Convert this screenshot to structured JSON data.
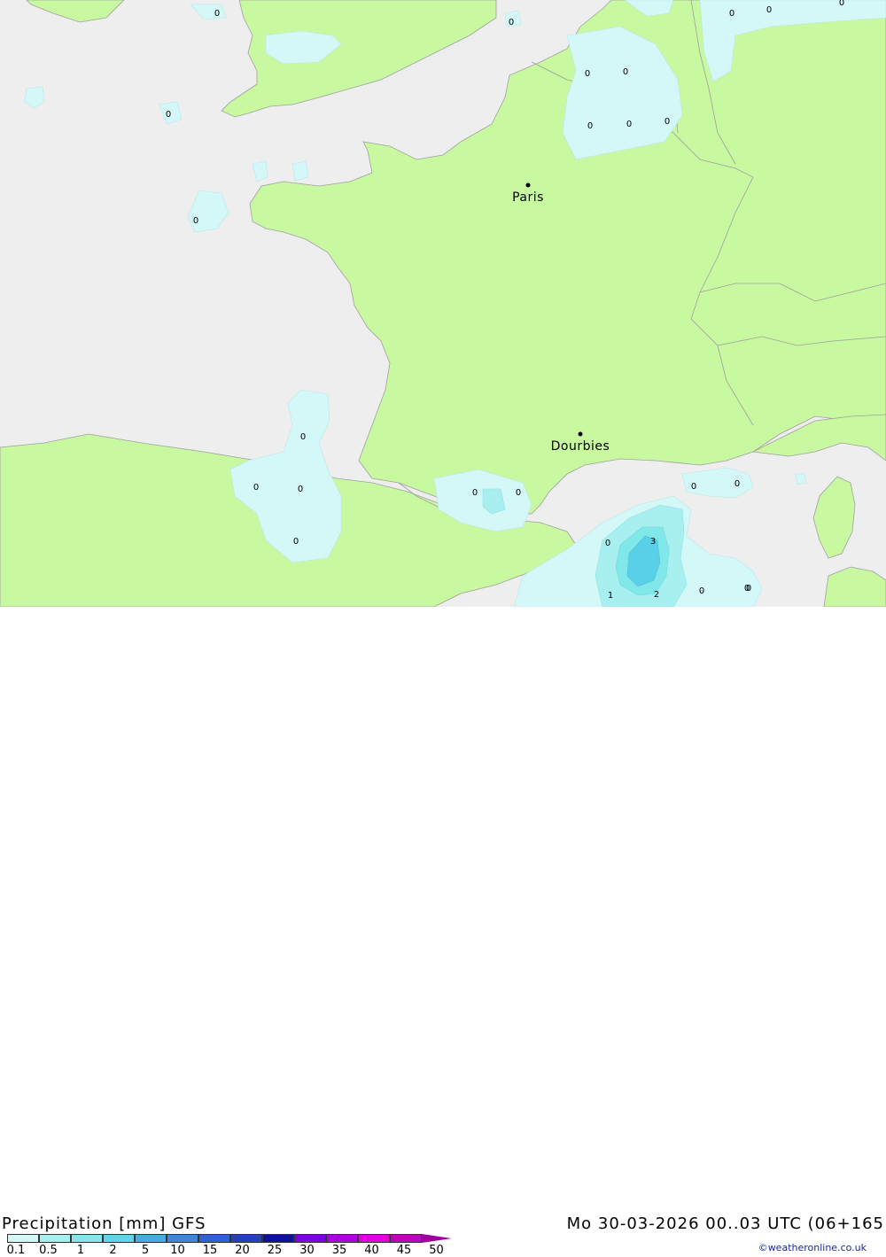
{
  "title": {
    "product": "Precipitation [mm]",
    "model": "GFS",
    "datetime": "Mo 30-03-2026 00..03 UTC (06+165"
  },
  "cities": [
    {
      "name": "Paris"
    },
    {
      "name": "Dourbies"
    }
  ],
  "point_values": [
    "0",
    "0",
    "0",
    "0",
    "0",
    "0",
    "0",
    "0",
    "0",
    "0",
    "0",
    "0",
    "0",
    "0",
    "0",
    "0",
    "0",
    "0",
    "0",
    "0",
    "0",
    "0",
    "3",
    "1",
    "2",
    "0",
    "0"
  ],
  "legend": {
    "ticks": [
      "0.1",
      "0.5",
      "1",
      "2",
      "5",
      "10",
      "15",
      "20",
      "25",
      "30",
      "35",
      "40",
      "45",
      "50"
    ],
    "colors": [
      "#d4f8f8",
      "#a8f0f0",
      "#80e8e8",
      "#58d8e8",
      "#40b0e0",
      "#3888e0",
      "#3060d8",
      "#2840c0",
      "#1010a0",
      "#8000e0",
      "#b000e0",
      "#e000e0",
      "#c000c0",
      "#a000a0"
    ]
  },
  "colors": {
    "land": "#c8f8a0",
    "sea": "#eeeeee",
    "border": "#a0a0a0",
    "precip_light": "#d4f8f8",
    "precip_med": "#80e8e8",
    "precip_high": "#58d8e8"
  },
  "credit": "©weatheronline.co.uk"
}
